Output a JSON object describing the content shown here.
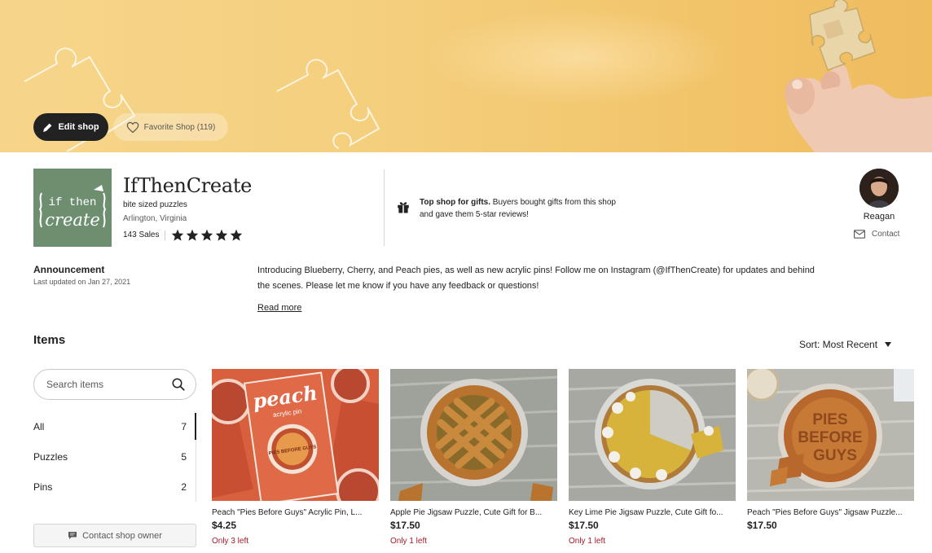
{
  "banner": {
    "edit_label": "Edit shop",
    "favorite_label": "Favorite Shop (119)"
  },
  "shop": {
    "name": "IfThenCreate",
    "tagline": "bite sized puzzles",
    "location": "Arlington, Virginia",
    "sales": "143 Sales",
    "rating_stars": 5,
    "logo_text_top": "if then",
    "logo_text_bottom": "create",
    "gift_bold": "Top shop for gifts.",
    "gift_rest": " Buyers bought gifts from this shop and gave them 5-star reviews!"
  },
  "owner": {
    "name": "Reagan",
    "contact_label": "Contact"
  },
  "announcement": {
    "title": "Announcement",
    "date": "Last updated on Jan 27, 2021",
    "text": "Introducing Blueberry, Cherry, and Peach pies, as well as new acrylic pins! Follow me on Instagram (@IfThenCreate) for updates and behind the scenes. Please let me know if you have any feedback or questions!",
    "read_more": "Read more"
  },
  "items": {
    "title": "Items",
    "sort_label": "Sort: Most Recent",
    "search_placeholder": "Search items",
    "categories": [
      {
        "label": "All",
        "count": "7"
      },
      {
        "label": "Puzzles",
        "count": "5"
      },
      {
        "label": "Pins",
        "count": "2"
      }
    ],
    "contact_owner": "Contact shop owner",
    "listings": [
      {
        "title": "Peach \"Pies Before Guys\" Acrylic Pin, L...",
        "price": "$4.25",
        "stock": "Only 3 left",
        "pin_title": "peach",
        "pin_sub": "acrylic pin",
        "pin_pie_text": "PIES BEFORE GUYS"
      },
      {
        "title": "Apple Pie Jigsaw Puzzle, Cute Gift for B...",
        "price": "$17.50",
        "stock": "Only 1 left"
      },
      {
        "title": "Key Lime Pie Jigsaw Puzzle, Cute Gift fo...",
        "price": "$17.50",
        "stock": "Only 1 left"
      },
      {
        "title": "Peach \"Pies Before Guys\" Jigsaw Puzzle...",
        "price": "$17.50",
        "stock": "",
        "pie_text_1": "PIES",
        "pie_text_2": "BEFORE",
        "pie_text_3": "GUYS"
      }
    ]
  },
  "colors": {
    "banner": "#f4cf7e",
    "logo_bg": "#6d8f70",
    "stock_red": "#a61a2e",
    "dark_button": "#222222"
  },
  "icons": [
    "pencil-icon",
    "heart-icon",
    "star-icon",
    "gift-icon",
    "mail-icon",
    "search-icon",
    "caret-down-icon",
    "chat-icon"
  ]
}
